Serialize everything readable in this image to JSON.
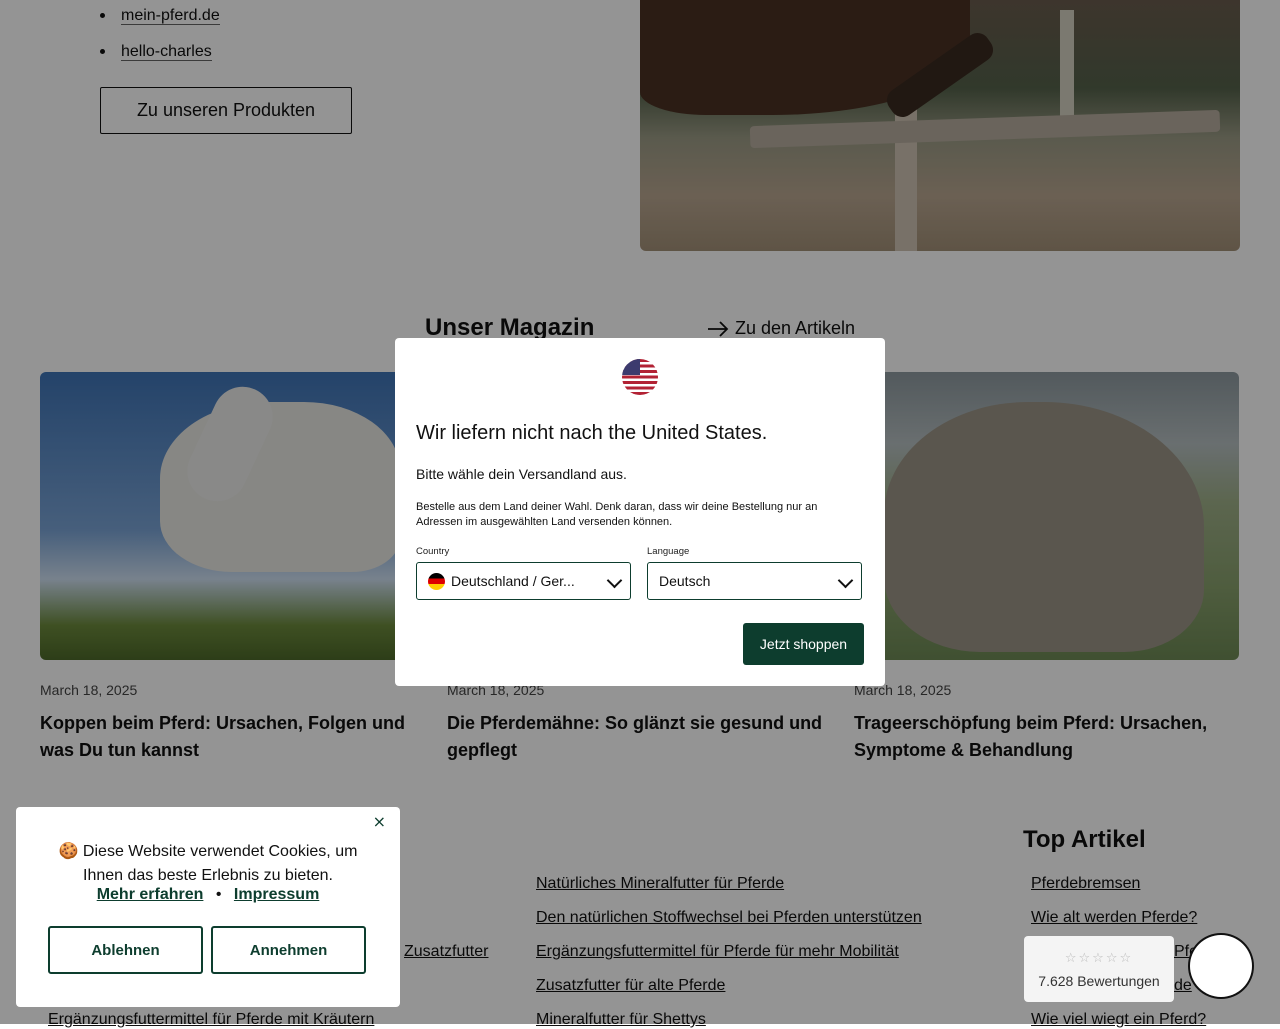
{
  "brands": {
    "items": [
      "mein-pferd.de",
      "hello-charles"
    ]
  },
  "products_button": "Zu unseren Produkten",
  "magazine": {
    "title": "Unser Magazin",
    "link_label": "Zu den Artikeln",
    "articles": [
      {
        "date": "March 18, 2025",
        "title": "Koppen beim Pferd: Ursachen, Folgen und was Du tun kannst"
      },
      {
        "date": "March 18, 2025",
        "title": "Die Pferdemähne: So glänzt sie gesund und gepflegt"
      },
      {
        "date": "March 18, 2025",
        "title": "Trageerschöpfung beim Pferd: Ursachen, Symptome & Behandlung"
      }
    ]
  },
  "footer": {
    "col1": [
      "Zusatzfutter",
      "Ergänzungsfuttermittel für Pferde mit Kräutern"
    ],
    "col2": [
      "Natürliches Mineralfutter für Pferde",
      "Den natürlichen Stoffwechsel bei Pferden unterstützen",
      "Ergänzungsfuttermittel für Pferde für mehr Mobilität",
      "Zusatzfutter für alte Pferde",
      "Mineralfutter für Shettys"
    ],
    "top_title": "Top Artikel",
    "col3": [
      "Pferdebremsen",
      "Wie alt werden Pferde?",
      "Pfe",
      "de",
      "Wie viel wiegt ein Pferd?"
    ]
  },
  "modal": {
    "title": "Wir liefern nicht nach the United States.",
    "subtitle": "Bitte wähle dein Versandland aus.",
    "note": "Bestelle aus dem Land deiner Wahl. Denk daran, dass wir deine Bestellung nur an Adressen im ausgewählten Land versenden können.",
    "country_label": "Country",
    "country_value": "Deutschland / Ger...",
    "language_label": "Language",
    "language_value": "Deutsch",
    "shop_button": "Jetzt shoppen"
  },
  "cookie": {
    "text": "🍪 Diese Website verwendet Cookies, um Ihnen das beste Erlebnis zu bieten.",
    "learn_more": "Mehr erfahren",
    "separator": "•",
    "imprint": "Impressum",
    "decline": "Ablehnen",
    "accept": "Annehmen",
    "close": "×"
  },
  "reviews": {
    "stars": "☆☆☆☆☆",
    "count": "7.628 Bewertungen"
  },
  "colors": {
    "brand_green": "#0d3d2e",
    "overlay": "rgba(0,0,0,0.42)"
  }
}
